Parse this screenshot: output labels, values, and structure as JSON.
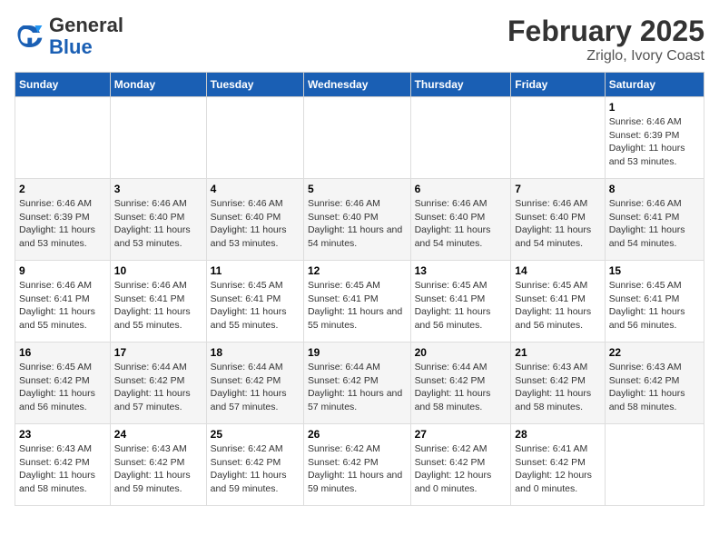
{
  "logo": {
    "text_general": "General",
    "text_blue": "Blue"
  },
  "title": "February 2025",
  "subtitle": "Zriglo, Ivory Coast",
  "days_of_week": [
    "Sunday",
    "Monday",
    "Tuesday",
    "Wednesday",
    "Thursday",
    "Friday",
    "Saturday"
  ],
  "weeks": [
    [
      {
        "day": "",
        "detail": ""
      },
      {
        "day": "",
        "detail": ""
      },
      {
        "day": "",
        "detail": ""
      },
      {
        "day": "",
        "detail": ""
      },
      {
        "day": "",
        "detail": ""
      },
      {
        "day": "",
        "detail": ""
      },
      {
        "day": "1",
        "detail": "Sunrise: 6:46 AM\nSunset: 6:39 PM\nDaylight: 11 hours and 53 minutes."
      }
    ],
    [
      {
        "day": "2",
        "detail": "Sunrise: 6:46 AM\nSunset: 6:39 PM\nDaylight: 11 hours and 53 minutes."
      },
      {
        "day": "3",
        "detail": "Sunrise: 6:46 AM\nSunset: 6:40 PM\nDaylight: 11 hours and 53 minutes."
      },
      {
        "day": "4",
        "detail": "Sunrise: 6:46 AM\nSunset: 6:40 PM\nDaylight: 11 hours and 53 minutes."
      },
      {
        "day": "5",
        "detail": "Sunrise: 6:46 AM\nSunset: 6:40 PM\nDaylight: 11 hours and 54 minutes."
      },
      {
        "day": "6",
        "detail": "Sunrise: 6:46 AM\nSunset: 6:40 PM\nDaylight: 11 hours and 54 minutes."
      },
      {
        "day": "7",
        "detail": "Sunrise: 6:46 AM\nSunset: 6:40 PM\nDaylight: 11 hours and 54 minutes."
      },
      {
        "day": "8",
        "detail": "Sunrise: 6:46 AM\nSunset: 6:41 PM\nDaylight: 11 hours and 54 minutes."
      }
    ],
    [
      {
        "day": "9",
        "detail": "Sunrise: 6:46 AM\nSunset: 6:41 PM\nDaylight: 11 hours and 55 minutes."
      },
      {
        "day": "10",
        "detail": "Sunrise: 6:46 AM\nSunset: 6:41 PM\nDaylight: 11 hours and 55 minutes."
      },
      {
        "day": "11",
        "detail": "Sunrise: 6:45 AM\nSunset: 6:41 PM\nDaylight: 11 hours and 55 minutes."
      },
      {
        "day": "12",
        "detail": "Sunrise: 6:45 AM\nSunset: 6:41 PM\nDaylight: 11 hours and 55 minutes."
      },
      {
        "day": "13",
        "detail": "Sunrise: 6:45 AM\nSunset: 6:41 PM\nDaylight: 11 hours and 56 minutes."
      },
      {
        "day": "14",
        "detail": "Sunrise: 6:45 AM\nSunset: 6:41 PM\nDaylight: 11 hours and 56 minutes."
      },
      {
        "day": "15",
        "detail": "Sunrise: 6:45 AM\nSunset: 6:41 PM\nDaylight: 11 hours and 56 minutes."
      }
    ],
    [
      {
        "day": "16",
        "detail": "Sunrise: 6:45 AM\nSunset: 6:42 PM\nDaylight: 11 hours and 56 minutes."
      },
      {
        "day": "17",
        "detail": "Sunrise: 6:44 AM\nSunset: 6:42 PM\nDaylight: 11 hours and 57 minutes."
      },
      {
        "day": "18",
        "detail": "Sunrise: 6:44 AM\nSunset: 6:42 PM\nDaylight: 11 hours and 57 minutes."
      },
      {
        "day": "19",
        "detail": "Sunrise: 6:44 AM\nSunset: 6:42 PM\nDaylight: 11 hours and 57 minutes."
      },
      {
        "day": "20",
        "detail": "Sunrise: 6:44 AM\nSunset: 6:42 PM\nDaylight: 11 hours and 58 minutes."
      },
      {
        "day": "21",
        "detail": "Sunrise: 6:43 AM\nSunset: 6:42 PM\nDaylight: 11 hours and 58 minutes."
      },
      {
        "day": "22",
        "detail": "Sunrise: 6:43 AM\nSunset: 6:42 PM\nDaylight: 11 hours and 58 minutes."
      }
    ],
    [
      {
        "day": "23",
        "detail": "Sunrise: 6:43 AM\nSunset: 6:42 PM\nDaylight: 11 hours and 58 minutes."
      },
      {
        "day": "24",
        "detail": "Sunrise: 6:43 AM\nSunset: 6:42 PM\nDaylight: 11 hours and 59 minutes."
      },
      {
        "day": "25",
        "detail": "Sunrise: 6:42 AM\nSunset: 6:42 PM\nDaylight: 11 hours and 59 minutes."
      },
      {
        "day": "26",
        "detail": "Sunrise: 6:42 AM\nSunset: 6:42 PM\nDaylight: 11 hours and 59 minutes."
      },
      {
        "day": "27",
        "detail": "Sunrise: 6:42 AM\nSunset: 6:42 PM\nDaylight: 12 hours and 0 minutes."
      },
      {
        "day": "28",
        "detail": "Sunrise: 6:41 AM\nSunset: 6:42 PM\nDaylight: 12 hours and 0 minutes."
      },
      {
        "day": "",
        "detail": ""
      }
    ]
  ]
}
